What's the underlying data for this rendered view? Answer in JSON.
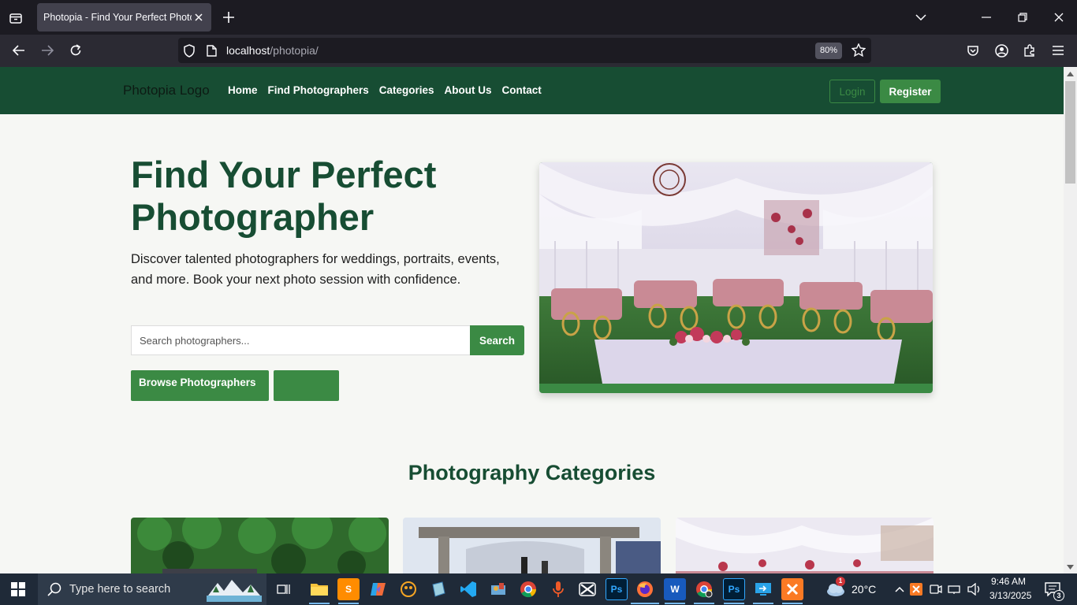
{
  "browser": {
    "tab_title": "Photopia - Find Your Perfect Photographer",
    "url_host": "localhost",
    "url_path": "/photopia/",
    "zoom": "80%"
  },
  "site": {
    "logo": "Photopia Logo",
    "nav": [
      "Home",
      "Find Photographers",
      "Categories",
      "About Us",
      "Contact"
    ],
    "login": "Login",
    "register": "Register"
  },
  "hero": {
    "title": "Find Your Perfect Photographer",
    "subtitle": "Discover talented photographers for weddings, portraits, events, and more. Book your next photo session with confidence.",
    "search_placeholder": "Search photographers...",
    "search_button": "Search",
    "browse_button": "Browse Photographers",
    "second_button": ""
  },
  "categories": {
    "title": "Photography Categories"
  },
  "taskbar": {
    "search_placeholder": "Type here to search",
    "weather": "20°C",
    "time": "9:46 AM",
    "date": "3/13/2025",
    "notifications": "3",
    "weather_badge": "1"
  }
}
